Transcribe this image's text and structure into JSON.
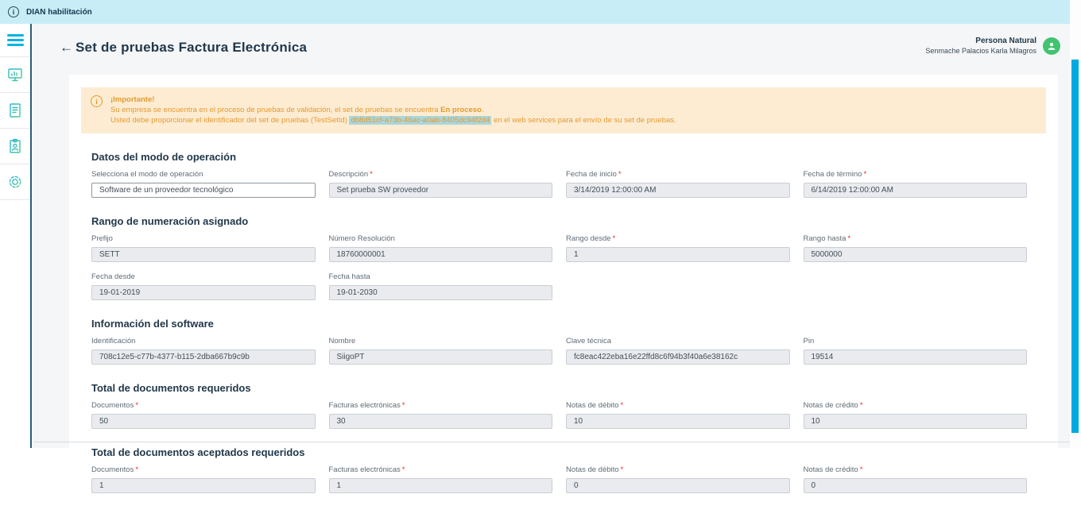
{
  "topbar": {
    "app_title": "DIAN habilitación"
  },
  "header": {
    "back_arrow": "←",
    "title": "Set de pruebas Factura Electrónica"
  },
  "user": {
    "type": "Persona Natural",
    "name": "Senmache Palacios Karla Milagros"
  },
  "sidebar": {
    "icons": [
      "menu-icon",
      "dashboard-monitor-icon",
      "document-icon",
      "clipboard-person-icon",
      "settings-gear-icon"
    ]
  },
  "alert": {
    "title": "¡Importante!",
    "line1_prefix": "Su empresa se encuentra en el proceso de pruebas de validación, el set de pruebas se encuentra ",
    "line1_bold": "En proceso",
    "line1_suffix": ".",
    "line2_prefix": "Usted debe proporcionar el identificador del set de pruebas (TestSetId) ",
    "test_set_id": "db8d51cf-a73b-46ac-a0ab-8405dc94f2d4",
    "line2_suffix": " en el web services para el envío de su set de pruebas."
  },
  "sections": [
    {
      "title": "Datos del modo de operación",
      "fields": [
        {
          "label": "Selecciona el modo de operación",
          "value": "Software de un proveedor tecnológico"
        },
        {
          "label": "Descripción",
          "req": "*",
          "value": "Set prueba SW proveedor"
        },
        {
          "label": "Fecha de inicio",
          "req": "*",
          "value": "3/14/2019 12:00:00 AM"
        },
        {
          "label": "Fecha de término",
          "req": "*",
          "value": "6/14/2019 12:00:00 AM"
        }
      ]
    },
    {
      "title": "Rango de numeración asignado",
      "fields": [
        {
          "label": "Prefijo",
          "value": "SETT"
        },
        {
          "label": "Número Resolución",
          "value": "18760000001"
        },
        {
          "label": "Rango desde",
          "req": "*",
          "value": "1"
        },
        {
          "label": "Rango hasta",
          "req": "*",
          "value": "5000000"
        },
        {
          "label": "Fecha desde",
          "value": "19-01-2019"
        },
        {
          "label": "Fecha hasta",
          "value": "19-01-2030"
        }
      ]
    },
    {
      "title": "Información del software",
      "fields": [
        {
          "label": "Identificación",
          "value": "708c12e5-c77b-4377-b115-2dba667b9c9b"
        },
        {
          "label": "Nombre",
          "value": "SiigoPT"
        },
        {
          "label": "Clave técnica",
          "value": "fc8eac422eba16e22ffd8c6f94b3f40a6e38162c"
        },
        {
          "label": "Pin",
          "value": "19514"
        }
      ]
    },
    {
      "title": "Total de documentos requeridos",
      "fields": [
        {
          "label": "Documentos",
          "req": "*",
          "value": "50"
        },
        {
          "label": "Facturas electrónicas",
          "req": "*",
          "value": "30"
        },
        {
          "label": "Notas de débito",
          "req": "*",
          "value": "10"
        },
        {
          "label": "Notas de crédito",
          "req": "*",
          "value": "10"
        }
      ]
    },
    {
      "title": "Total de documentos aceptados requeridos",
      "fields": [
        {
          "label": "Documentos",
          "req": "*",
          "value": "1"
        },
        {
          "label": "Facturas electrónicas",
          "req": "*",
          "value": "1"
        },
        {
          "label": "Notas de débito",
          "req": "*",
          "value": "0"
        },
        {
          "label": "Notas de crédito",
          "req": "*",
          "value": "0"
        }
      ]
    }
  ],
  "colors": {
    "topbar_bg": "#c8edf6",
    "accent_cyan": "#00b2e3",
    "scrollbar": "#00a9e0",
    "avatar_green": "#41c36f",
    "alert_bg": "#fdecd2",
    "alert_text": "#e5992f",
    "highlight_bg": "#a9d7de",
    "required_red": "#e02b2b",
    "heading_navy": "#22384a"
  }
}
